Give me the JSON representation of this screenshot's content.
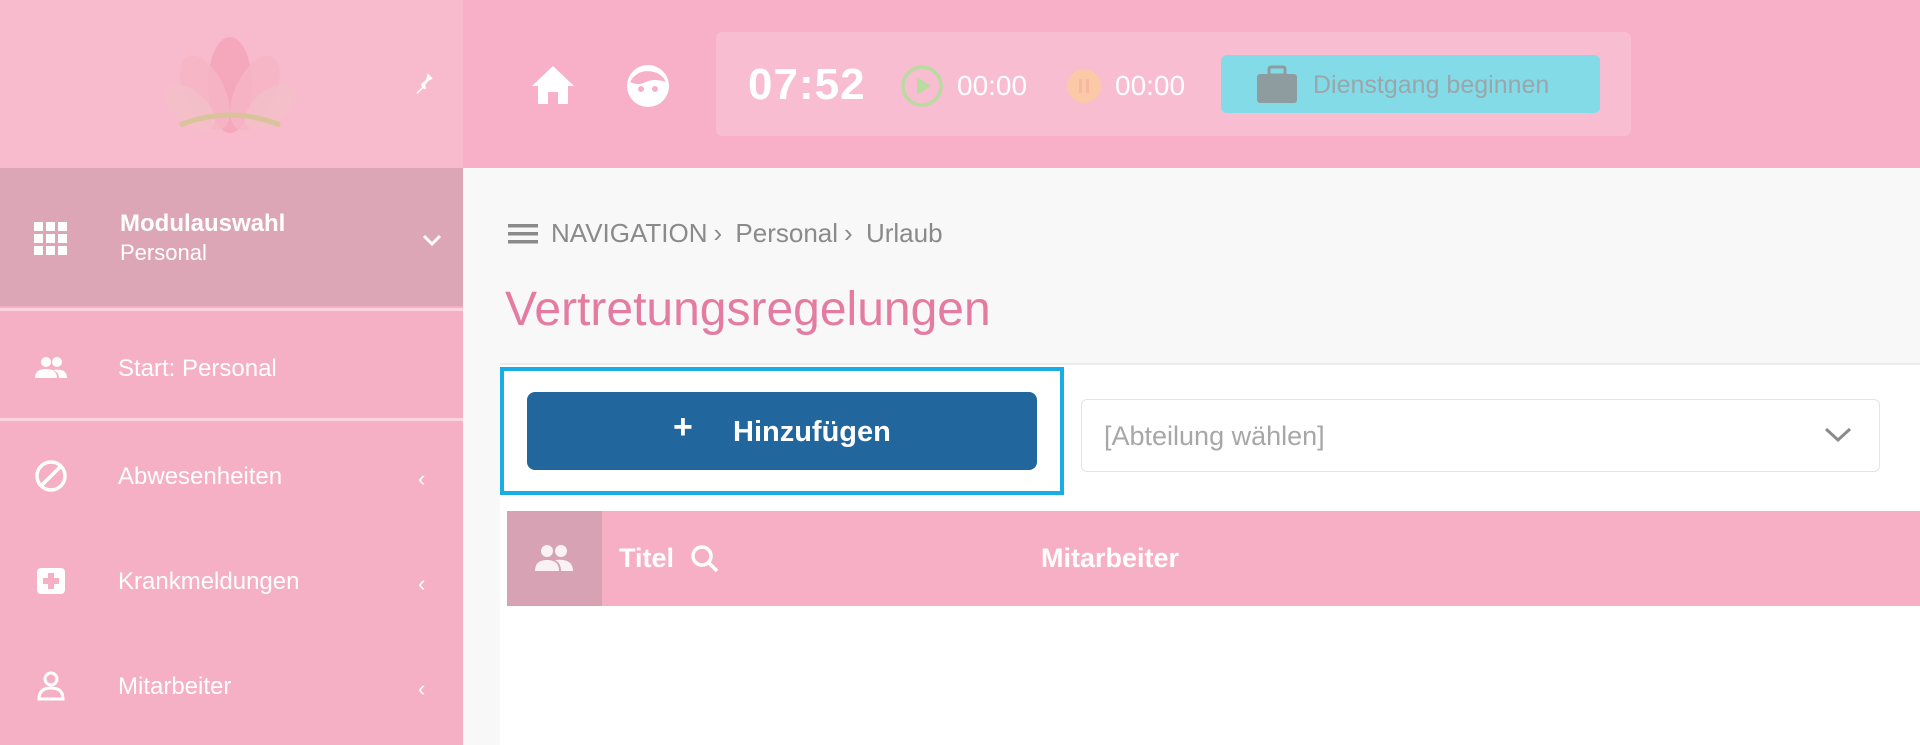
{
  "sidebar": {
    "module": {
      "title": "Modulauswahl",
      "subtitle": "Personal"
    },
    "items": [
      {
        "label": "Start: Personal",
        "icon": "people-icon"
      },
      {
        "label": "Abwesenheiten",
        "icon": "block-icon"
      },
      {
        "label": "Krankmeldungen",
        "icon": "medical-icon"
      },
      {
        "label": "Mitarbeiter",
        "icon": "person-icon"
      }
    ]
  },
  "topbar": {
    "clock": "07:52",
    "work_time": "00:00",
    "pause_time": "00:00",
    "dienstgang_label": "Dienstgang beginnen"
  },
  "breadcrumb": {
    "root": "NAVIGATION",
    "level1": "Personal",
    "level2": "Urlaub"
  },
  "page_title": "Vertretungsregelungen",
  "toolbar": {
    "add_label": "Hinzufügen",
    "department_placeholder": "[Abteilung wählen]"
  },
  "table": {
    "columns": [
      "Titel",
      "Mitarbeiter"
    ]
  },
  "colors": {
    "brand_pink": "#f7b0c7",
    "title_pink": "#e47ba0",
    "primary_blue": "#22669e",
    "highlight": "#18aee5",
    "dienstgang_bg": "#82dbe6"
  }
}
